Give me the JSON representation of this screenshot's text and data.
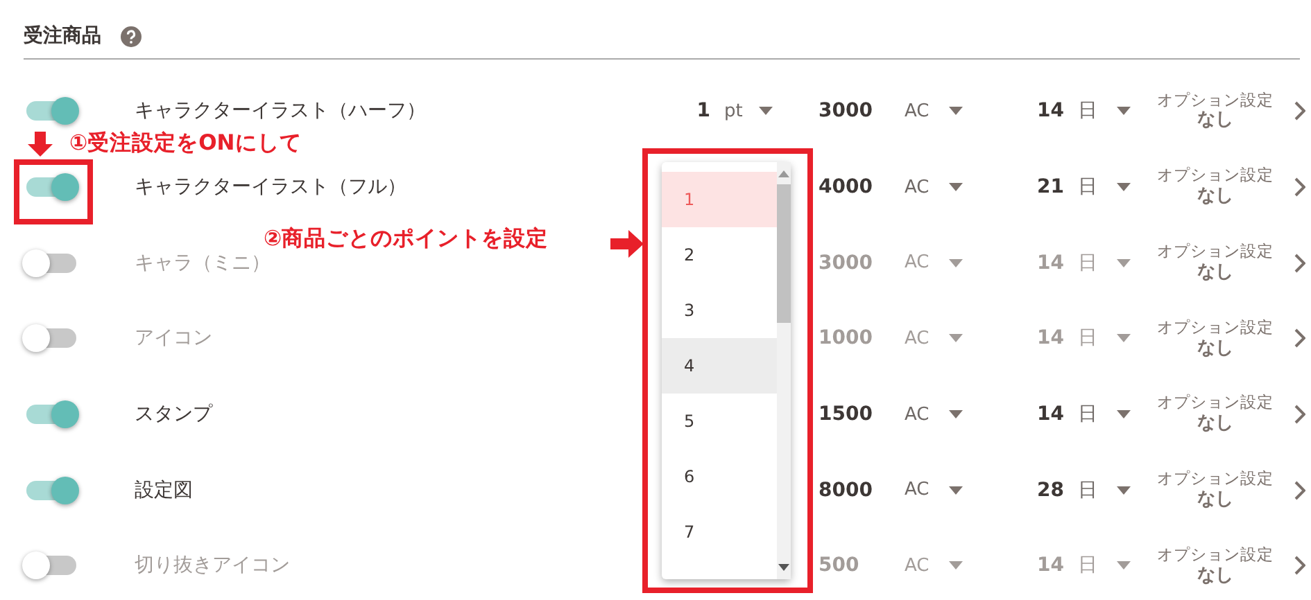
{
  "section": {
    "title": "受注商品"
  },
  "products": [
    {
      "on": true,
      "name": "キャラクターイラスト（ハーフ）",
      "point": "1",
      "point_unit": "pt",
      "price": "3000",
      "currency": "AC",
      "days": "14",
      "days_unit": "日",
      "option_label": "オプション設定",
      "option_value": "なし"
    },
    {
      "on": true,
      "name": "キャラクターイラスト（フル）",
      "price": "4000",
      "currency": "AC",
      "days": "21",
      "days_unit": "日",
      "option_label": "オプション設定",
      "option_value": "なし"
    },
    {
      "on": false,
      "name": "キャラ（ミニ）",
      "price": "3000",
      "currency": "AC",
      "days": "14",
      "days_unit": "日",
      "option_label": "オプション設定",
      "option_value": "なし"
    },
    {
      "on": false,
      "name": "アイコン",
      "price": "1000",
      "currency": "AC",
      "days": "14",
      "days_unit": "日",
      "option_label": "オプション設定",
      "option_value": "なし"
    },
    {
      "on": true,
      "name": "スタンプ",
      "price": "1500",
      "currency": "AC",
      "days": "14",
      "days_unit": "日",
      "option_label": "オプション設定",
      "option_value": "なし"
    },
    {
      "on": true,
      "name": "設定図",
      "price": "8000",
      "currency": "AC",
      "days": "28",
      "days_unit": "日",
      "option_label": "オプション設定",
      "option_value": "なし"
    },
    {
      "on": false,
      "name": "切り抜きアイコン",
      "price": "500",
      "currency": "AC",
      "days": "14",
      "days_unit": "日",
      "option_label": "オプション設定",
      "option_value": "なし"
    }
  ],
  "point_dropdown": {
    "options": [
      {
        "label": "1",
        "selected": true,
        "hovered": false
      },
      {
        "label": "2",
        "selected": false,
        "hovered": false
      },
      {
        "label": "3",
        "selected": false,
        "hovered": false
      },
      {
        "label": "4",
        "selected": false,
        "hovered": true
      },
      {
        "label": "5",
        "selected": false,
        "hovered": false
      },
      {
        "label": "6",
        "selected": false,
        "hovered": false
      },
      {
        "label": "7",
        "selected": false,
        "hovered": false
      }
    ]
  },
  "annotations": [
    {
      "text": "①受注設定をONにして"
    },
    {
      "text": "②商品ごとのポイントを設定"
    }
  ]
}
